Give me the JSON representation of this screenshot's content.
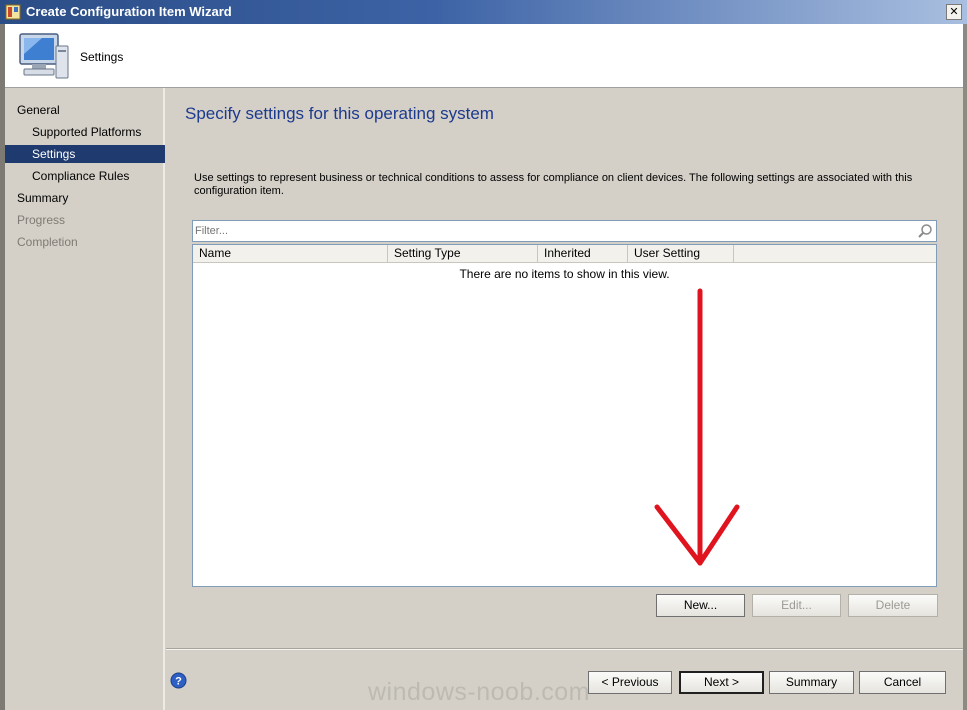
{
  "window": {
    "title": "Create Configuration Item Wizard",
    "close_label": "✕"
  },
  "header": {
    "page_name": "Settings"
  },
  "nav": {
    "items": [
      {
        "label": "General",
        "level": "top",
        "state": "normal"
      },
      {
        "label": "Supported Platforms",
        "level": "sub",
        "state": "normal"
      },
      {
        "label": "Settings",
        "level": "sub",
        "state": "active"
      },
      {
        "label": "Compliance Rules",
        "level": "sub",
        "state": "normal"
      },
      {
        "label": "Summary",
        "level": "top",
        "state": "normal"
      },
      {
        "label": "Progress",
        "level": "top",
        "state": "disabled"
      },
      {
        "label": "Completion",
        "level": "top",
        "state": "disabled"
      }
    ]
  },
  "content": {
    "title": "Specify settings for this operating system",
    "description": "Use settings to represent business or technical conditions to assess for compliance on client devices. The following settings are associated with this configuration item.",
    "filter_placeholder": "Filter...",
    "columns": [
      "Name",
      "Setting Type",
      "Inherited",
      "User Setting"
    ],
    "empty_message": "There are no items to show in this view.",
    "buttons": {
      "new": "New...",
      "edit": "Edit...",
      "delete": "Delete"
    }
  },
  "footer": {
    "previous": "< Previous",
    "next": "Next >",
    "summary": "Summary",
    "cancel": "Cancel"
  },
  "watermark": "windows-noob.com",
  "colors": {
    "accent": "#1c3a8e",
    "selection": "#1f3a6e",
    "arrow": "#e0141e"
  }
}
